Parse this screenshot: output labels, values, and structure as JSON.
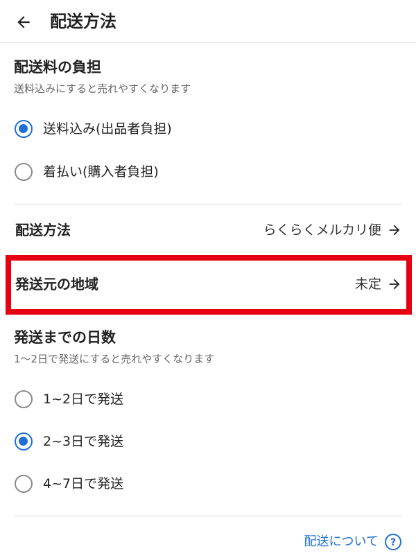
{
  "header": {
    "title": "配送方法"
  },
  "shipping_fee": {
    "title": "配送料の負担",
    "subtitle": "送料込みにすると売れやすくなります",
    "options": [
      {
        "label": "送料込み(出品者負担)",
        "selected": true
      },
      {
        "label": "着払い(購入者負担)",
        "selected": false
      }
    ]
  },
  "shipping_method": {
    "title": "配送方法",
    "value": "らくらくメルカリ便"
  },
  "ship_from": {
    "title": "発送元の地域",
    "value": "未定"
  },
  "shipping_days": {
    "title": "発送までの日数",
    "subtitle": "1〜2日で発送にすると売れやすくなります",
    "options": [
      {
        "label": "1~2日で発送",
        "selected": false
      },
      {
        "label": "2~3日で発送",
        "selected": true
      },
      {
        "label": "4~7日で発送",
        "selected": false
      }
    ]
  },
  "footer": {
    "link_label": "配送について"
  },
  "colors": {
    "accent": "#1f6fd6",
    "highlight": "#e60012"
  }
}
